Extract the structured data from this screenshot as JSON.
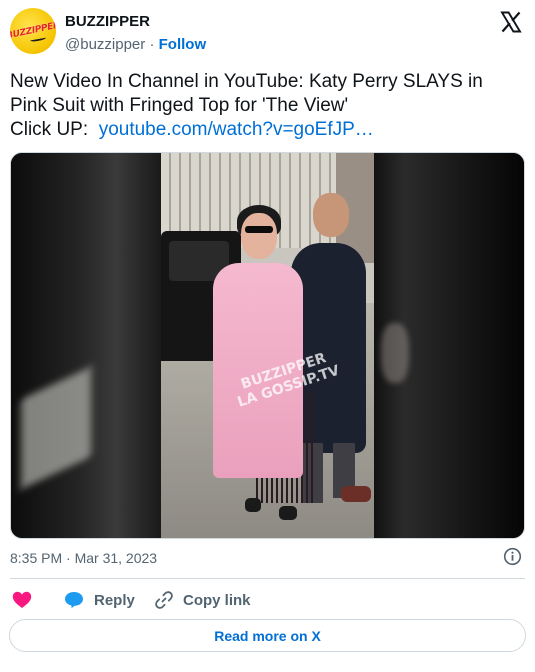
{
  "header": {
    "display_name": "BUZZIPPER",
    "handle": "@buzzipper",
    "separator": " · ",
    "follow_label": "Follow",
    "avatar_text": "BUZZIPPER"
  },
  "tweet": {
    "line1": "New Video In Channel in YouTube: Katy Perry SLAYS in",
    "line2": "Pink Suit with Fringed Top for 'The View'",
    "line3_prefix": "Click UP:  ",
    "link_text": "youtube.com/watch?v=goEfJP…"
  },
  "media": {
    "watermark_line1": "BUZZIPPER",
    "watermark_line2": "LA GOSSIP.TV"
  },
  "meta": {
    "timestamp": "8:35 PM · Mar 31, 2023"
  },
  "actions": {
    "reply_label": "Reply",
    "copy_link_label": "Copy link"
  },
  "footer": {
    "read_more_label": "Read more on X"
  },
  "colors": {
    "link": "#006fd6",
    "heart": "#f91880",
    "reply_bubble": "#1d9bf0",
    "muted_text": "#536471",
    "border": "#cfd9de"
  },
  "icons": {
    "logo": "x-logo-icon",
    "info": "info-icon",
    "heart": "heart-icon",
    "reply": "reply-bubble-icon",
    "copy": "link-icon"
  }
}
